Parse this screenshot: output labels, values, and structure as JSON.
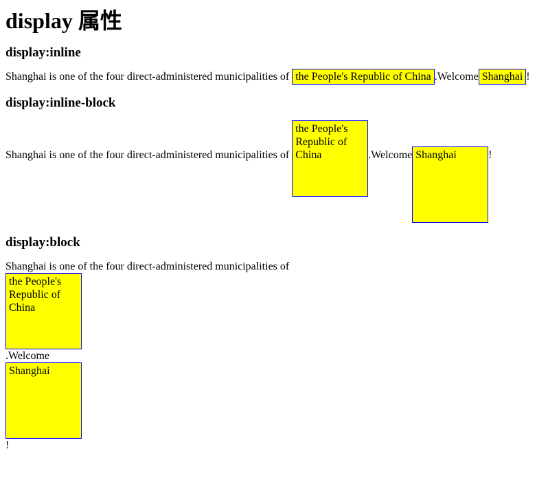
{
  "page": {
    "title": "display 属性"
  },
  "colors": {
    "highlight_background": "#ffff00",
    "highlight_border": "#0000ff",
    "text": "#000000",
    "page_background": "#ffffff"
  },
  "sections": [
    {
      "id": "inline",
      "heading": "display:inline",
      "text_lead": "Shanghai is one of the four direct-administered municipalities of ",
      "box1_text": "the People's Republic of China",
      "text_middle": ".Welcome",
      "box2_text": "Shanghai",
      "text_end": "!"
    },
    {
      "id": "inline-block",
      "heading": "display:inline-block",
      "text_lead": "Shanghai is one of the four direct-administered municipalities of ",
      "box1_text": "the People's Republic of China",
      "text_middle": ".Welcome",
      "box2_text": "Shanghai",
      "text_end": "!"
    },
    {
      "id": "block",
      "heading": "display:block",
      "text_lead": "Shanghai is one of the four direct-administered municipalities of",
      "box1_text": "the People's Republic of China",
      "text_middle": ".Welcome",
      "box2_text": "Shanghai",
      "text_end": "!"
    }
  ]
}
